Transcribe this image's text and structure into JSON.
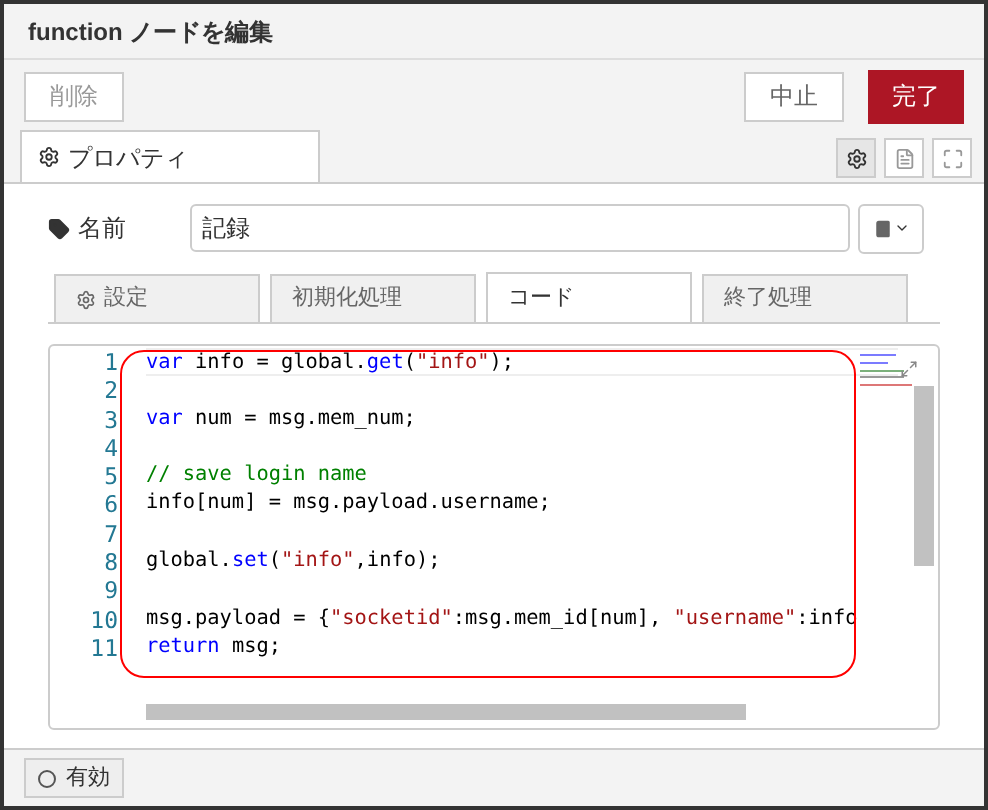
{
  "window": {
    "title": "function ノードを編集"
  },
  "toolbar": {
    "delete": "削除",
    "cancel": "中止",
    "done": "完了"
  },
  "tabs": [
    {
      "label": "プロパティ",
      "selected": true
    }
  ],
  "name_field": {
    "label": "名前",
    "value": "記録"
  },
  "sub_tabs": [
    {
      "label": "設定",
      "selected": false,
      "icon": true
    },
    {
      "label": "初期化処理",
      "selected": false,
      "icon": false
    },
    {
      "label": "コード",
      "selected": true,
      "icon": false
    },
    {
      "label": "終了処理",
      "selected": false,
      "icon": false
    }
  ],
  "code": [
    {
      "number": "1",
      "tokens": [
        {
          "kind": "keyword",
          "text": "var"
        },
        {
          "kind": "plain",
          "text": " info = global."
        },
        {
          "kind": "keyword",
          "text": "get"
        },
        {
          "kind": "plain",
          "text": "("
        },
        {
          "kind": "string",
          "text": "\"info\""
        },
        {
          "kind": "plain",
          "text": ");"
        }
      ]
    },
    {
      "number": "2"
    },
    {
      "number": "3",
      "tokens": [
        {
          "kind": "keyword",
          "text": "var"
        },
        {
          "kind": "plain",
          "text": " num = msg.mem_num;"
        }
      ]
    },
    {
      "number": "4"
    },
    {
      "number": "5",
      "tokens": [
        {
          "kind": "comment",
          "text": "// save login name"
        }
      ]
    },
    {
      "number": "6",
      "tokens": [
        {
          "kind": "plain",
          "text": "info[num] = msg.payload.username;"
        }
      ]
    },
    {
      "number": "7"
    },
    {
      "number": "8",
      "tokens": [
        {
          "kind": "plain",
          "text": "global."
        },
        {
          "kind": "keyword",
          "text": "set"
        },
        {
          "kind": "plain",
          "text": "("
        },
        {
          "kind": "string",
          "text": "\"info\""
        },
        {
          "kind": "plain",
          "text": ",info);"
        }
      ]
    },
    {
      "number": "9"
    },
    {
      "number": "10",
      "tokens": [
        {
          "kind": "plain",
          "text": "msg.payload = {"
        },
        {
          "kind": "string",
          "text": "\"socketid\""
        },
        {
          "kind": "plain",
          "text": ":msg.mem_id[num], "
        },
        {
          "kind": "string",
          "text": "\"username\""
        },
        {
          "kind": "plain",
          "text": ":info"
        }
      ]
    },
    {
      "number": "11",
      "tokens": [
        {
          "kind": "keyword",
          "text": "return"
        },
        {
          "kind": "plain",
          "text": " msg;"
        }
      ]
    }
  ],
  "footer": {
    "enabled": "有効"
  }
}
